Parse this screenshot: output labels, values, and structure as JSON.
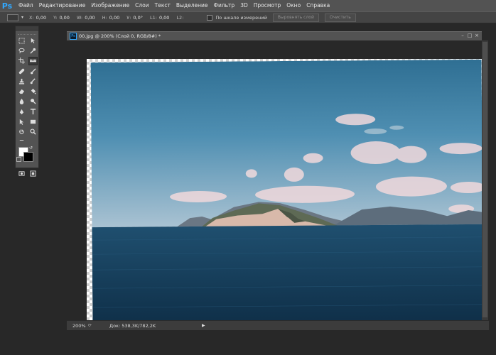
{
  "app": {
    "logo": "Ps"
  },
  "menu": [
    "Файл",
    "Редактирование",
    "Изображение",
    "Слои",
    "Текст",
    "Выделение",
    "Фильтр",
    "3D",
    "Просмотр",
    "Окно",
    "Справка"
  ],
  "options": {
    "fields": [
      {
        "label": "X:",
        "value": "0,00"
      },
      {
        "label": "Y:",
        "value": "0,00"
      },
      {
        "label": "W:",
        "value": "0,00"
      },
      {
        "label": "H:",
        "value": "0,00"
      },
      {
        "label": "У:",
        "value": "0,0°"
      },
      {
        "label": "L1:",
        "value": "0,00"
      },
      {
        "label": "L2:",
        "value": ""
      }
    ],
    "checkbox_label": "По шкале измерений",
    "straighten_button": "Выровнять слой",
    "clear_button": "Очистить"
  },
  "document": {
    "tab_title": "00.jpg @ 200% (Слой 0, RGB/8#) *"
  },
  "status": {
    "zoom": "200%",
    "doc_info": "Док: 538,3K/782,2K",
    "arrow": "▶"
  },
  "colors": {
    "accent": "#31a8ff",
    "panel": "#535353",
    "workspace": "#282828"
  }
}
